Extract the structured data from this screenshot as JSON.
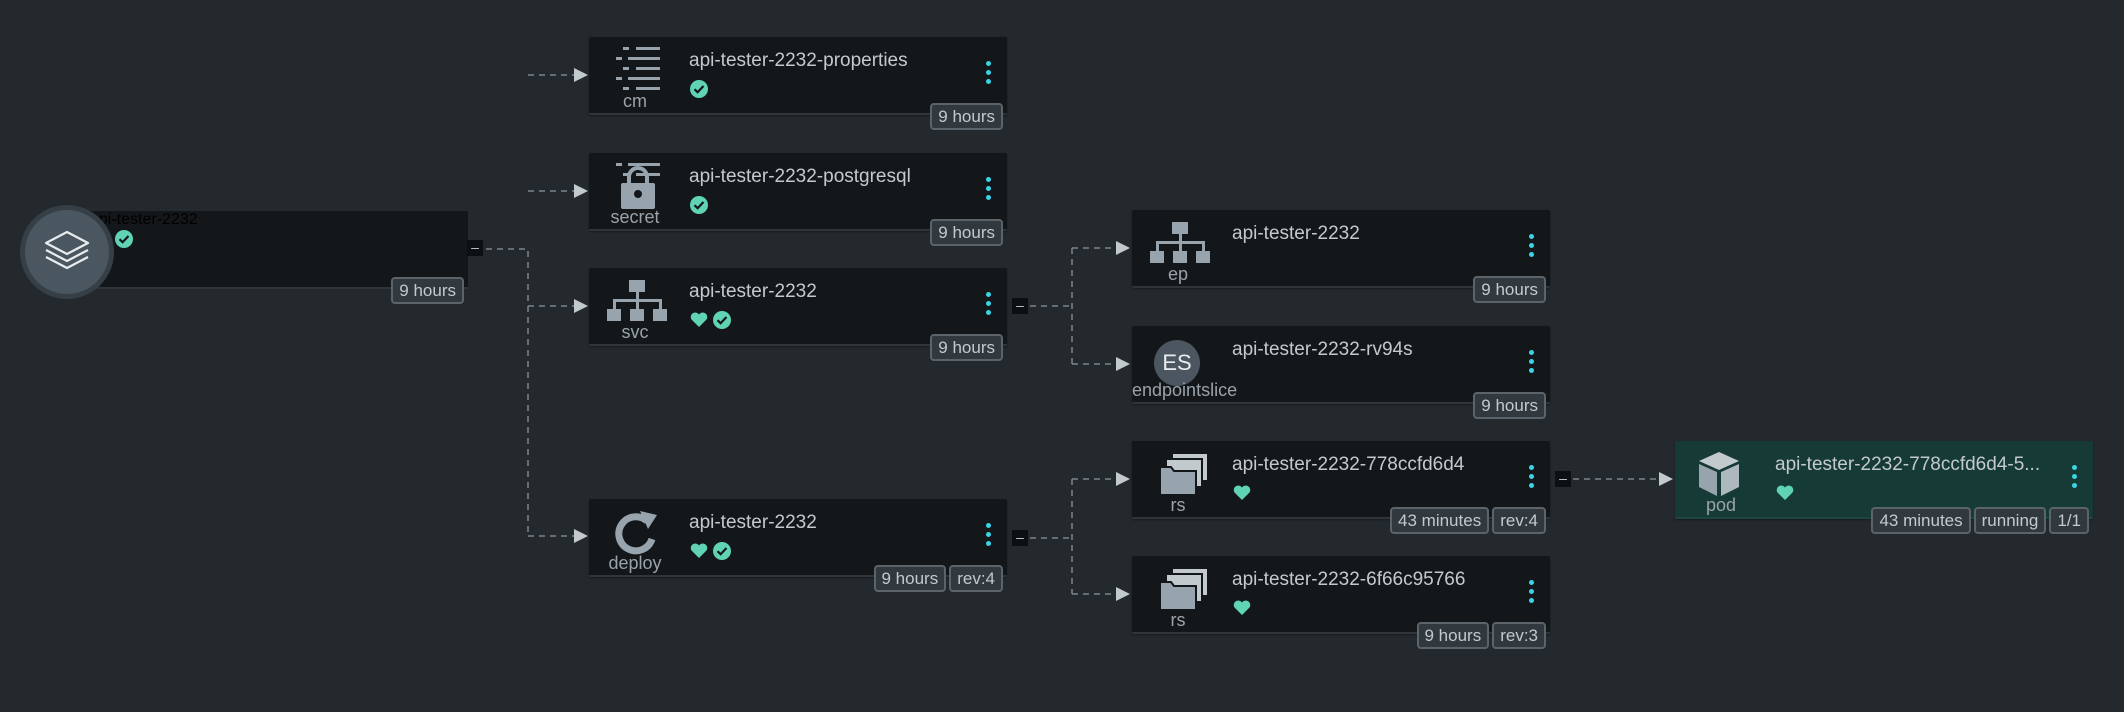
{
  "colors": {
    "background": "#24292d",
    "node": "#131719",
    "pod_node": "#163a36",
    "accent": "#3ad4e6",
    "healthy": "#5fd3b4"
  },
  "app": {
    "title": "api-tester-2232",
    "icon": "layers-icon",
    "badges": [
      "9 hours"
    ]
  },
  "nodes": [
    {
      "id": "cm",
      "kind": "cm",
      "icon": "config-map-icon",
      "title": "api-tester-2232-properties",
      "status": [
        "synced-icon"
      ],
      "badges": [
        "9 hours"
      ]
    },
    {
      "id": "secret",
      "kind": "secret",
      "icon": "lock-icon",
      "title": "api-tester-2232-postgresql",
      "status": [
        "synced-icon"
      ],
      "badges": [
        "9 hours"
      ]
    },
    {
      "id": "svc",
      "kind": "svc",
      "icon": "network-icon",
      "title": "api-tester-2232",
      "status": [
        "heart-icon",
        "synced-icon"
      ],
      "badges": [
        "9 hours"
      ]
    },
    {
      "id": "deploy",
      "kind": "deploy",
      "icon": "refresh-icon",
      "title": "api-tester-2232",
      "status": [
        "heart-icon",
        "synced-icon"
      ],
      "badges": [
        "9 hours",
        "rev:4"
      ]
    },
    {
      "id": "ep",
      "kind": "ep",
      "icon": "network-icon",
      "title": "api-tester-2232",
      "status": [],
      "badges": [
        "9 hours"
      ]
    },
    {
      "id": "es",
      "kind": "endpointslice",
      "icon": "ES",
      "title": "api-tester-2232-rv94s",
      "status": [],
      "badges": [
        "9 hours"
      ]
    },
    {
      "id": "rs1",
      "kind": "rs",
      "icon": "replicaset-icon",
      "title": "api-tester-2232-778ccfd6d4",
      "status": [
        "heart-icon"
      ],
      "badges": [
        "43 minutes",
        "rev:4"
      ]
    },
    {
      "id": "rs2",
      "kind": "rs",
      "icon": "replicaset-icon",
      "title": "api-tester-2232-6f66c95766",
      "status": [
        "heart-icon"
      ],
      "badges": [
        "9 hours",
        "rev:3"
      ]
    },
    {
      "id": "pod",
      "kind": "pod",
      "icon": "cube-icon",
      "title": "api-tester-2232-778ccfd6d4-5...",
      "status": [
        "heart-icon"
      ],
      "badges": [
        "43 minutes",
        "running",
        "1/1"
      ]
    }
  ],
  "collapse_symbol": "–"
}
